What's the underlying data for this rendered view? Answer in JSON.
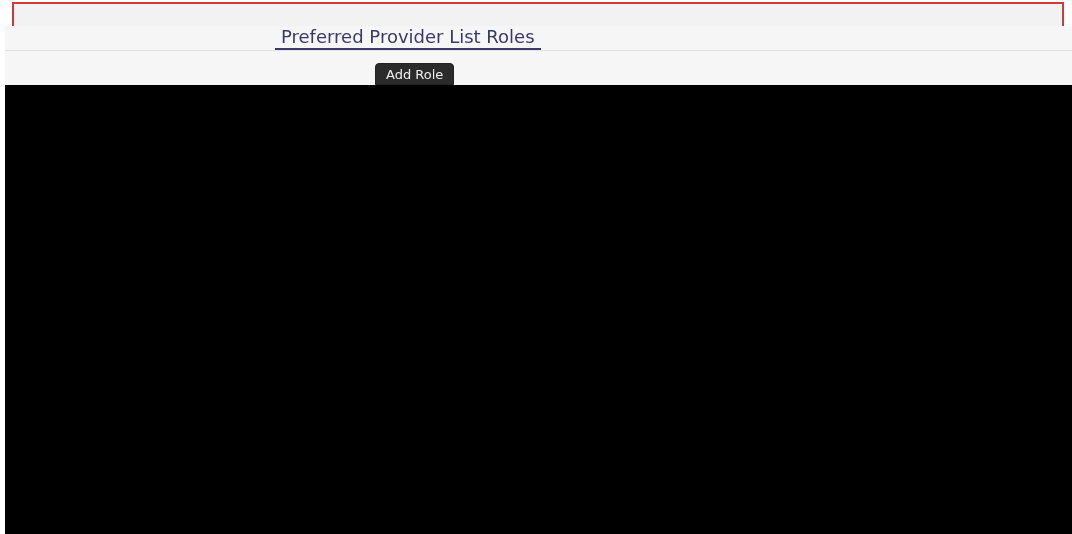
{
  "tab": {
    "label": "Preferred Provider List Roles",
    "selected": true
  },
  "toolbar": {
    "buttons": [
      "Add Role"
    ]
  }
}
